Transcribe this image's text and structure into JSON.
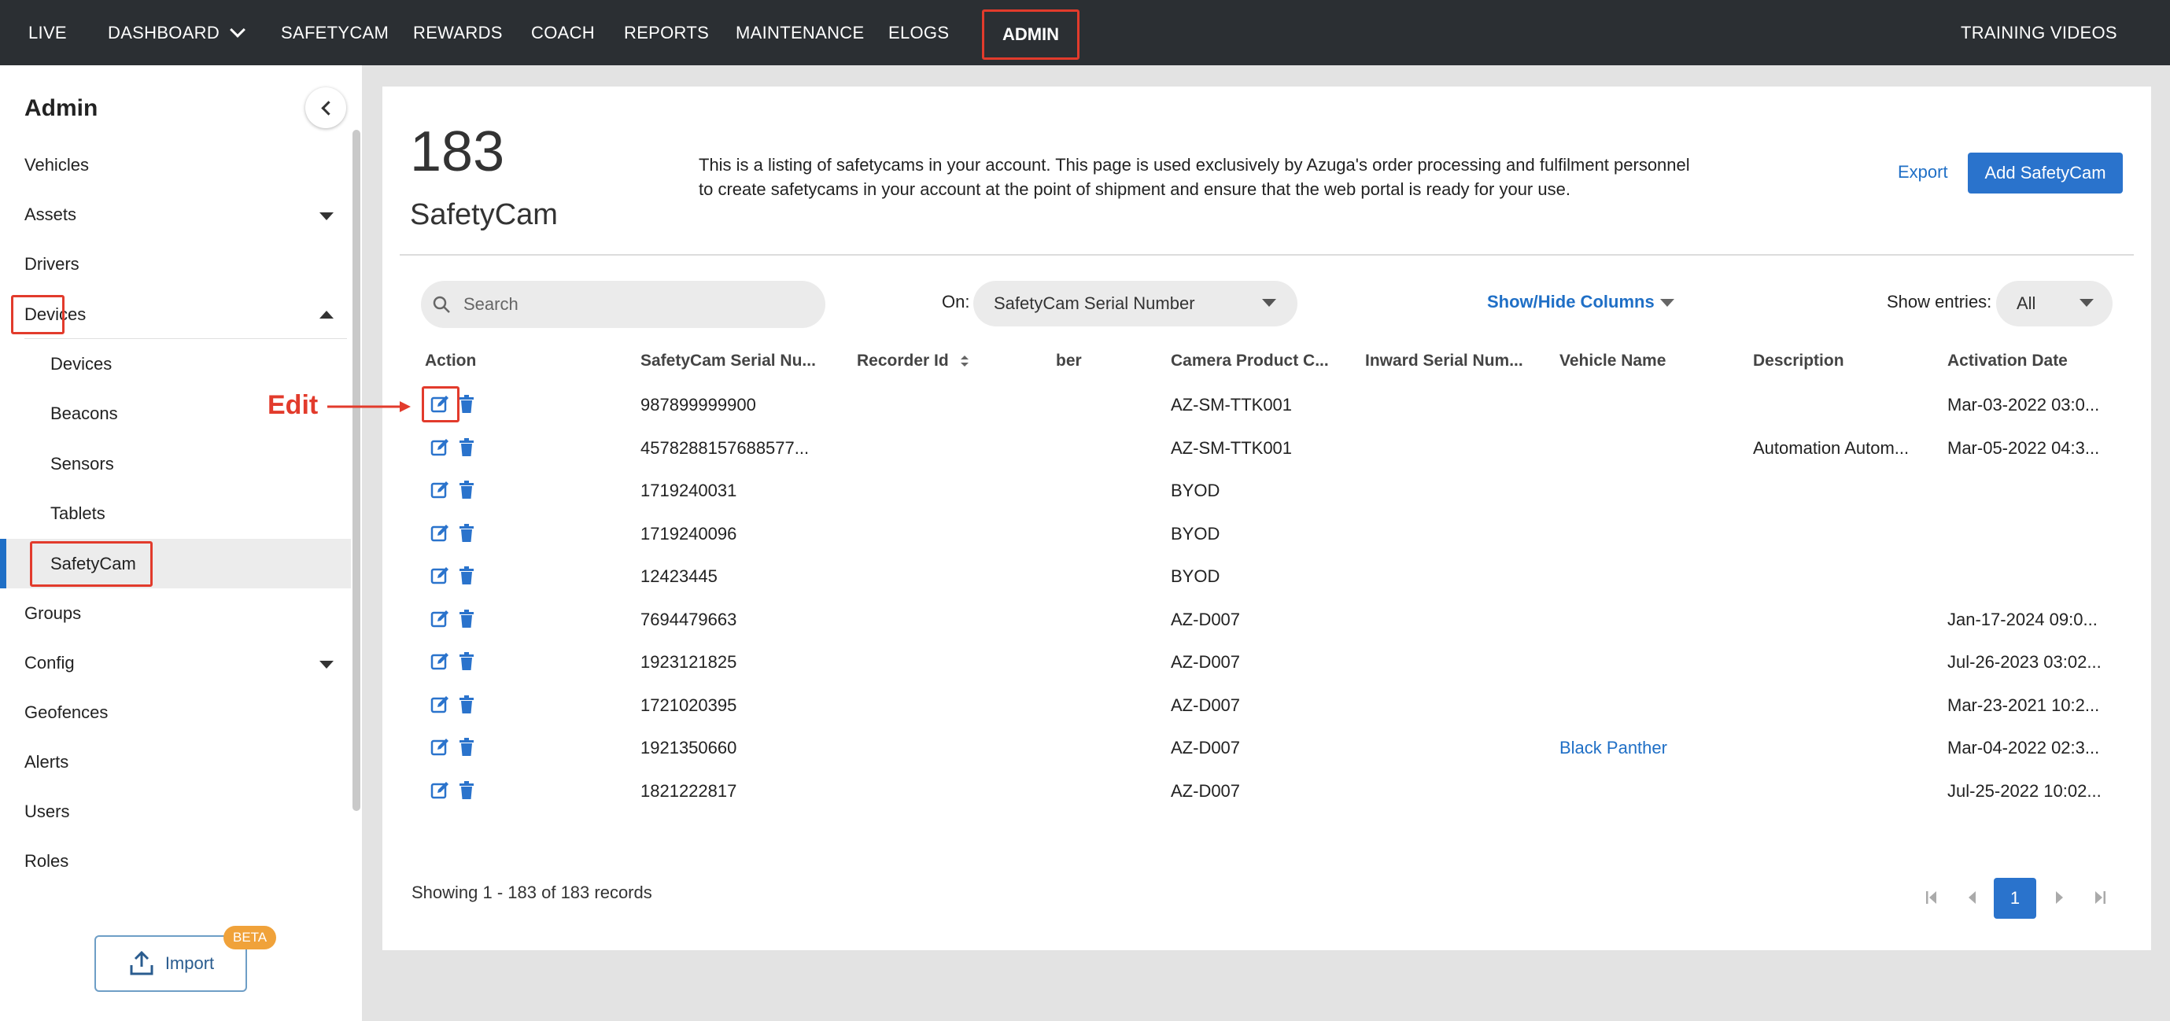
{
  "topnav": {
    "items": [
      "LIVE",
      "DASHBOARD",
      "SAFETYCAM",
      "REWARDS",
      "COACH",
      "REPORTS",
      "MAINTENANCE",
      "ELOGS",
      "ADMIN"
    ],
    "right": "TRAINING VIDEOS",
    "active": "ADMIN"
  },
  "sidebar": {
    "title": "Admin",
    "items": [
      "Vehicles",
      "Assets",
      "Drivers",
      "Devices",
      "Groups",
      "Config",
      "Geofences",
      "Alerts",
      "Users",
      "Roles"
    ],
    "device_subitems": [
      "Devices",
      "Beacons",
      "Sensors",
      "Tablets",
      "SafetyCam"
    ],
    "active_item": "SafetyCam",
    "import_label": "Import",
    "beta_label": "BETA"
  },
  "header": {
    "count": "183",
    "label": "SafetyCam",
    "description": "This is a listing of safetycams in your account. This page is used exclusively by Azuga's order processing and fulfilment personnel to create safetycams in your account at the point of shipment and ensure that the web portal is ready for your use.",
    "export": "Export",
    "add_button": "Add SafetyCam"
  },
  "toolbar": {
    "search_placeholder": "Search",
    "on_label": "On:",
    "on_value": "SafetyCam Serial Number",
    "show_hide": "Show/Hide Columns",
    "entries_label": "Show entries:",
    "entries_value": "All"
  },
  "table": {
    "headers": [
      "Action",
      "SafetyCam Serial Nu...",
      "Recorder Id",
      "ber",
      "Camera Product C...",
      "Inward Serial Num...",
      "Vehicle Name",
      "Description",
      "Activation Date"
    ],
    "rows": [
      {
        "serial": "987899999900",
        "product": "AZ-SM-TTK001",
        "vehicle": "",
        "description": "",
        "activation": "Mar-03-2022 03:0..."
      },
      {
        "serial": "4578288157688577...",
        "product": "AZ-SM-TTK001",
        "vehicle": "",
        "description": "Automation Autom...",
        "activation": "Mar-05-2022 04:3..."
      },
      {
        "serial": "1719240031",
        "product": "BYOD",
        "vehicle": "",
        "description": "",
        "activation": ""
      },
      {
        "serial": "1719240096",
        "product": "BYOD",
        "vehicle": "",
        "description": "",
        "activation": ""
      },
      {
        "serial": "12423445",
        "product": "BYOD",
        "vehicle": "",
        "description": "",
        "activation": ""
      },
      {
        "serial": "7694479663",
        "product": "AZ-D007",
        "vehicle": "",
        "description": "",
        "activation": "Jan-17-2024 09:0..."
      },
      {
        "serial": "1923121825",
        "product": "AZ-D007",
        "vehicle": "",
        "description": "",
        "activation": "Jul-26-2023 03:02..."
      },
      {
        "serial": "1721020395",
        "product": "AZ-D007",
        "vehicle": "",
        "description": "",
        "activation": "Mar-23-2021 10:2..."
      },
      {
        "serial": "1921350660",
        "product": "AZ-D007",
        "vehicle": "Black Panther",
        "description": "",
        "activation": "Mar-04-2022 02:3..."
      },
      {
        "serial": "1821222817",
        "product": "AZ-D007",
        "vehicle": "",
        "description": "",
        "activation": "Jul-25-2022 10:02..."
      }
    ]
  },
  "annotation": {
    "edit_label": "Edit"
  },
  "footer": {
    "showing": "Showing 1 - 183 of 183 records",
    "current_page": "1"
  },
  "colors": {
    "nav_bg": "#2b2f33",
    "accent": "#2a73cc",
    "highlight": "#e23b2c"
  }
}
